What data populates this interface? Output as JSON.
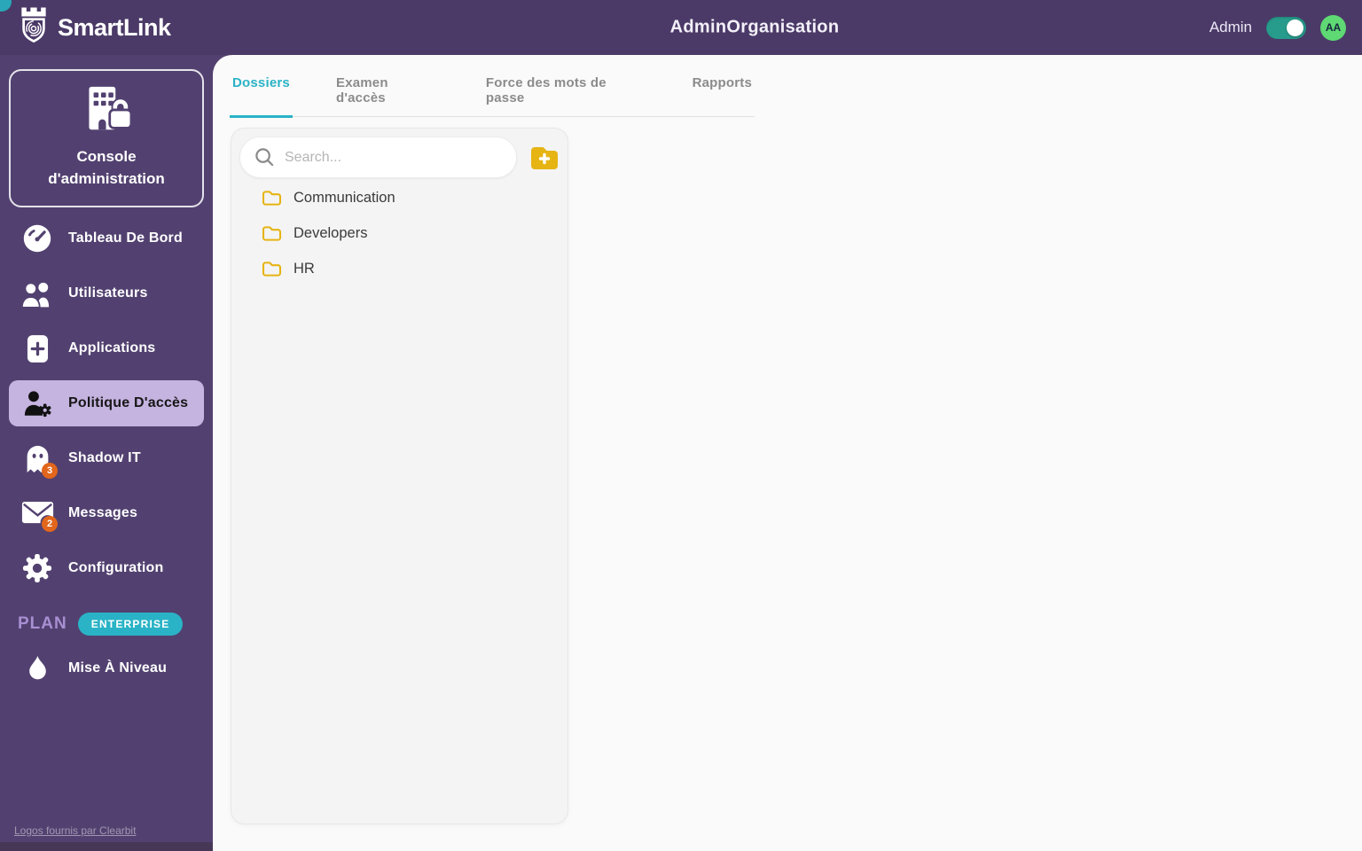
{
  "header": {
    "brand": "SmartLink",
    "title": "AdminOrganisation",
    "admin_label": "Admin",
    "toggle_state": "on",
    "avatar_text": "AA"
  },
  "sidebar": {
    "console_label": "Console\nd'administration",
    "items": [
      {
        "label": "Tableau De Bord",
        "icon": "gauge-icon",
        "selected": false
      },
      {
        "label": "Utilisateurs",
        "icon": "users-icon",
        "selected": false
      },
      {
        "label": "Applications",
        "icon": "app-plus-icon",
        "selected": false
      },
      {
        "label": "Politique D'accès",
        "icon": "user-gear-icon",
        "selected": true
      },
      {
        "label": "Shadow IT",
        "icon": "ghost-icon",
        "badge": "3",
        "selected": false
      },
      {
        "label": "Messages",
        "icon": "mail-icon",
        "badge": "2",
        "selected": false
      },
      {
        "label": "Configuration",
        "icon": "gear-icon",
        "selected": false
      }
    ],
    "plan_label": "PLAN",
    "plan_badge": "ENTERPRISE",
    "upgrade_label": "Mise À Niveau",
    "footer_link": "Logos fournis par Clearbit"
  },
  "main": {
    "tabs": [
      {
        "label": "Dossiers",
        "active": true
      },
      {
        "label": "Examen d'accès",
        "active": false
      },
      {
        "label": "Force des mots de passe",
        "active": false
      },
      {
        "label": "Rapports",
        "active": false
      }
    ],
    "search_placeholder": "Search...",
    "folders": [
      "Communication",
      "Developers",
      "HR"
    ]
  },
  "colors": {
    "purple-header": "#4b3a67",
    "purple-sidebar": "#524170",
    "lavender": "#c5b3e0",
    "teal": "#2ab3c6",
    "teal-toggle": "#279c8c",
    "green-avatar": "#5ed973",
    "yellow": "#e6b413",
    "orange": "#e2661b"
  }
}
